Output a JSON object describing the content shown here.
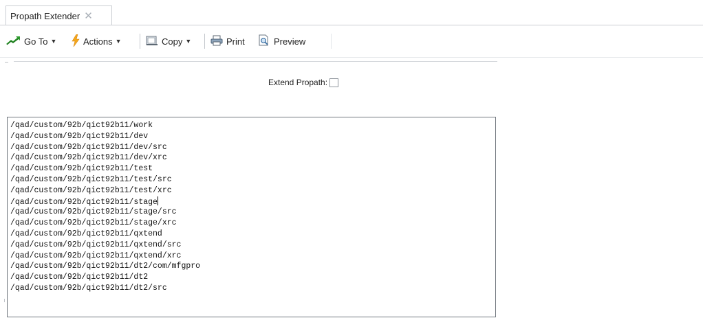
{
  "tab": {
    "title": "Propath Extender",
    "close_glyph": "✕"
  },
  "toolbar": {
    "goto_label": "Go To",
    "actions_label": "Actions",
    "copy_label": "Copy",
    "print_label": "Print",
    "preview_label": "Preview",
    "icons": {
      "goto": "green-arrow-icon",
      "actions": "lightning-icon",
      "copy": "copy-icon",
      "print": "printer-icon",
      "preview": "preview-icon"
    },
    "colors": {
      "goto_green": "#2e9b2e",
      "actions_orange": "#f4a81d"
    }
  },
  "form": {
    "extend_propath_label": "Extend Propath:",
    "extend_propath_checked": false
  },
  "propath": {
    "lines": [
      "/qad/custom/92b/qict92b11/work",
      "/qad/custom/92b/qict92b11/dev",
      "/qad/custom/92b/qict92b11/dev/src",
      "/qad/custom/92b/qict92b11/dev/xrc",
      "/qad/custom/92b/qict92b11/test",
      "/qad/custom/92b/qict92b11/test/src",
      "/qad/custom/92b/qict92b11/test/xrc",
      "/qad/custom/92b/qict92b11/stage",
      "/qad/custom/92b/qict92b11/stage/src",
      "/qad/custom/92b/qict92b11/stage/xrc",
      "/qad/custom/92b/qict92b11/qxtend",
      "/qad/custom/92b/qict92b11/qxtend/src",
      "/qad/custom/92b/qict92b11/qxtend/xrc",
      "/qad/custom/92b/qict92b11/dt2/com/mfgpro",
      "/qad/custom/92b/qict92b11/dt2",
      "/qad/custom/92b/qict92b11/dt2/src"
    ],
    "caret_line_index": 7
  }
}
